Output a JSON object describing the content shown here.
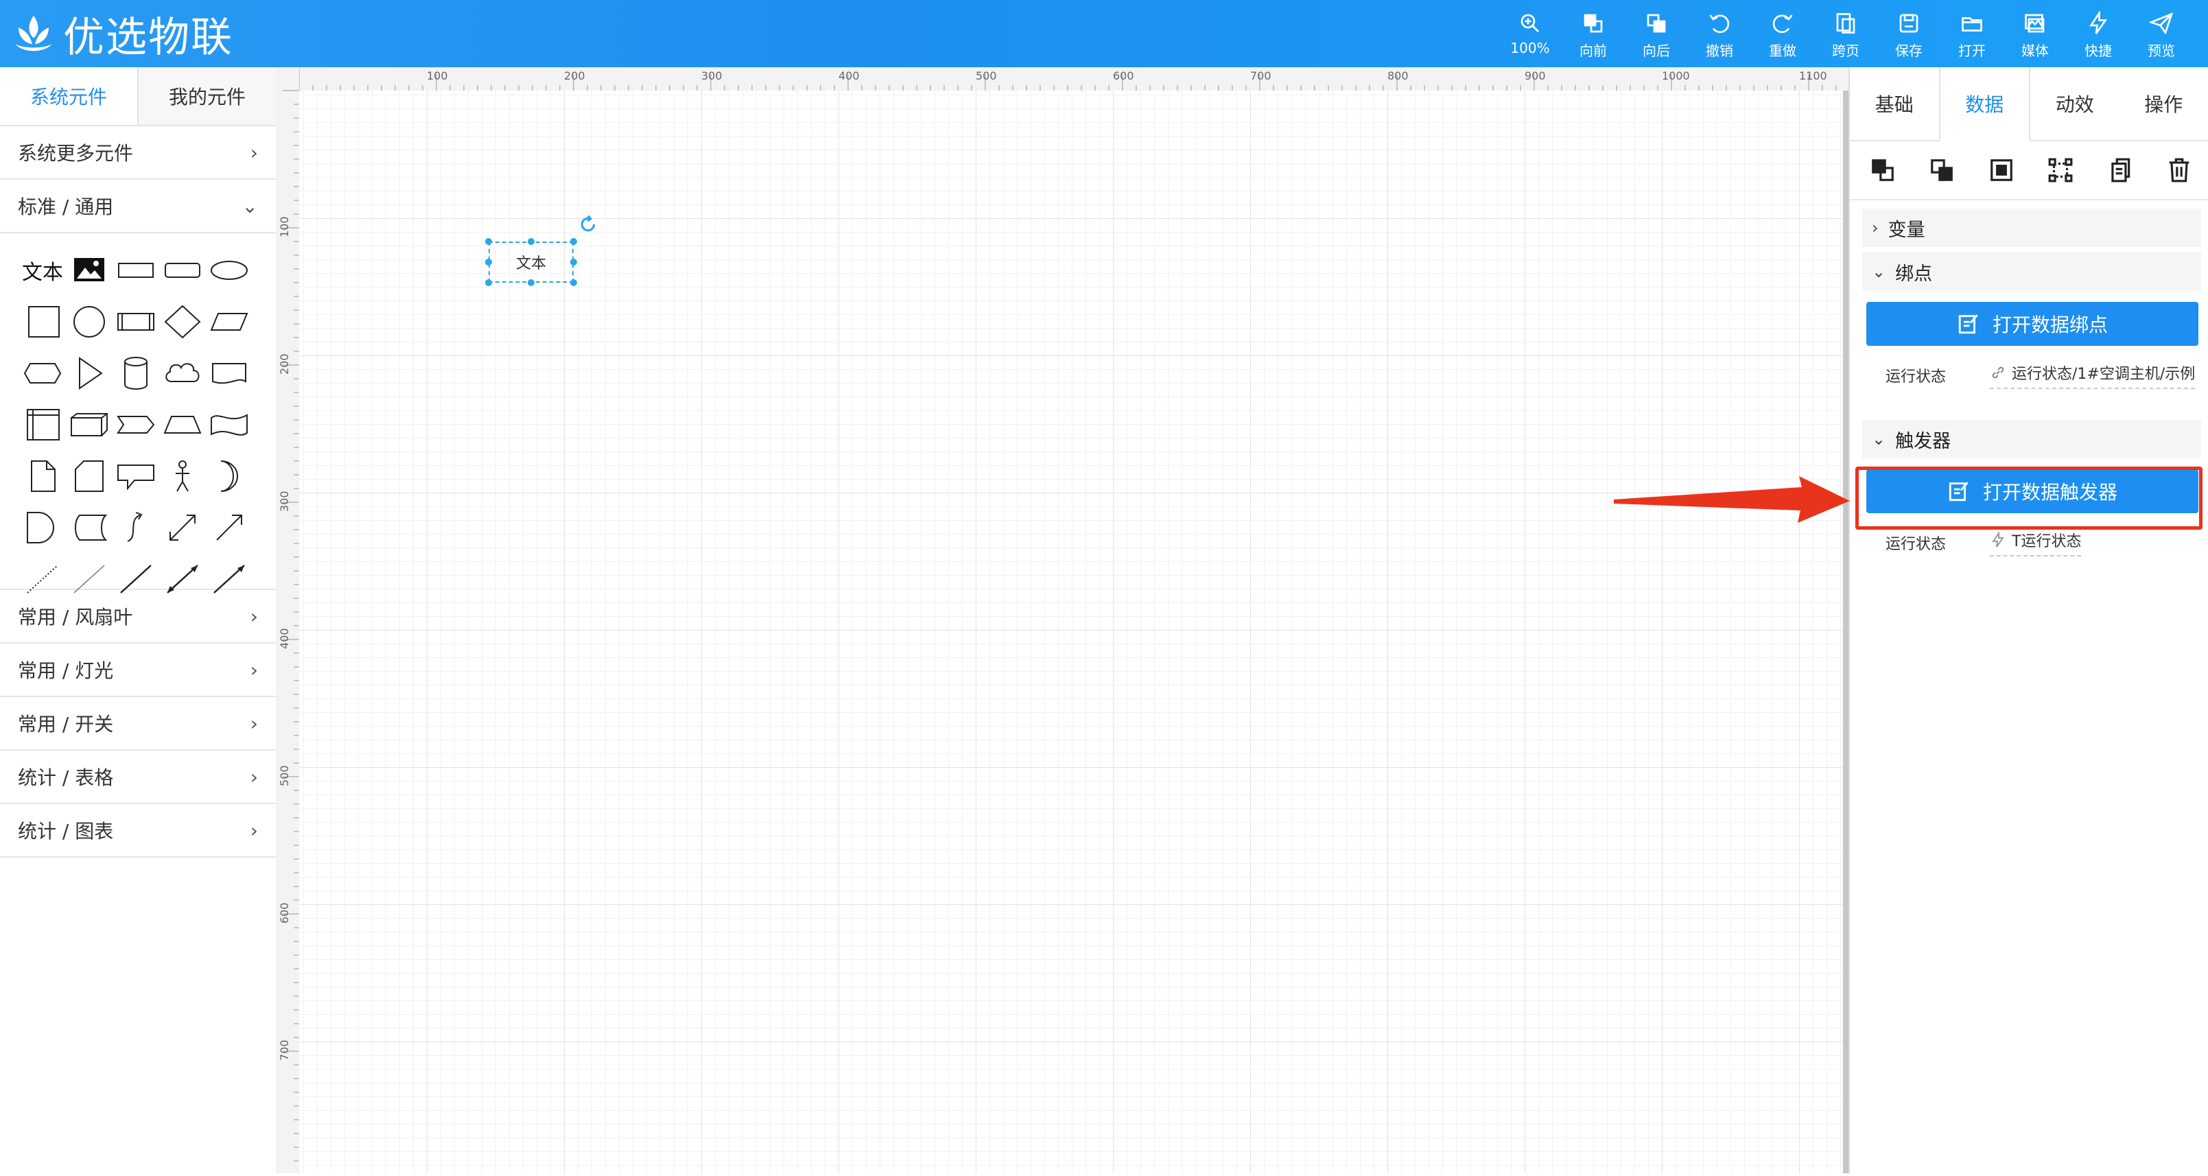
{
  "app": {
    "title": "优选物联"
  },
  "toolbar": {
    "items": [
      {
        "label": "100%",
        "icon": "zoom-icon"
      },
      {
        "label": "向前",
        "icon": "bring-forward-icon"
      },
      {
        "label": "向后",
        "icon": "send-backward-icon"
      },
      {
        "label": "撤销",
        "icon": "undo-icon"
      },
      {
        "label": "重做",
        "icon": "redo-icon"
      },
      {
        "label": "跨页",
        "icon": "cross-page-icon"
      },
      {
        "label": "保存",
        "icon": "save-icon"
      },
      {
        "label": "打开",
        "icon": "folder-open-icon"
      },
      {
        "label": "媒体",
        "icon": "media-icon"
      },
      {
        "label": "快捷",
        "icon": "lightning-icon"
      },
      {
        "label": "预览",
        "icon": "paper-plane-icon"
      }
    ]
  },
  "left_panel": {
    "tabs": [
      {
        "label": "系统元件"
      },
      {
        "label": "我的元件"
      }
    ],
    "more_label": "系统更多元件",
    "standard_label": "标准 / 通用",
    "text_shape": "文本",
    "categories": [
      {
        "label": "常用 / 风扇叶"
      },
      {
        "label": "常用 / 灯光"
      },
      {
        "label": "常用 / 开关"
      },
      {
        "label": "统计 / 表格"
      },
      {
        "label": "统计 / 图表"
      }
    ]
  },
  "ruler": {
    "top_ticks": [
      "100",
      "200",
      "300",
      "400",
      "500",
      "600",
      "700",
      "800",
      "900",
      "1000",
      "1100"
    ],
    "left_ticks": [
      "100",
      "200",
      "300",
      "400",
      "500",
      "600",
      "700"
    ]
  },
  "canvas": {
    "selected_element_text": "文本"
  },
  "right_panel": {
    "tabs": [
      {
        "label": "基础"
      },
      {
        "label": "数据"
      },
      {
        "label": "动效"
      },
      {
        "label": "操作"
      }
    ],
    "active_tab": "数据",
    "sections": {
      "variable": "变量",
      "binding": "绑点",
      "trigger": "触发器"
    },
    "binding_button": "打开数据绑点",
    "binding_prop": {
      "key": "运行状态",
      "value": "运行状态/1#空调主机/示例"
    },
    "trigger_button": "打开数据触发器",
    "trigger_prop": {
      "key": "运行状态",
      "value": "T运行状态"
    }
  },
  "colors": {
    "brand": "#1e8ff0",
    "highlight": "#e8341c",
    "selection": "#2aa7e6"
  }
}
